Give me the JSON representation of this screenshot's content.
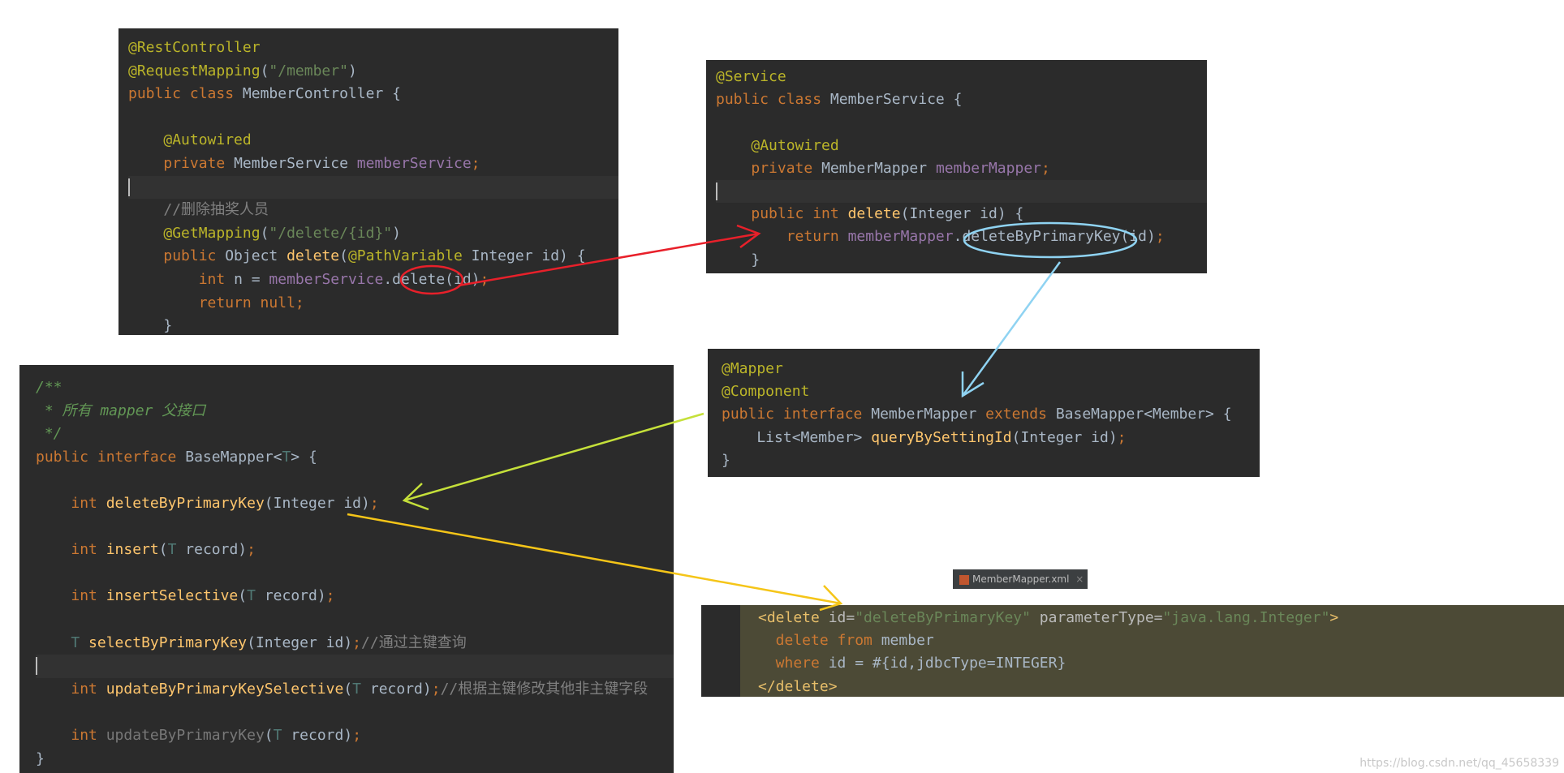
{
  "controller": {
    "lines": [
      {
        "parts": [
          {
            "t": "@RestController",
            "c": "ann"
          }
        ]
      },
      {
        "parts": [
          {
            "t": "@RequestMapping",
            "c": "ann"
          },
          {
            "t": "(",
            "c": ""
          },
          {
            "t": "\"/member\"",
            "c": "str"
          },
          {
            "t": ")",
            "c": ""
          }
        ]
      },
      {
        "parts": [
          {
            "t": "public class ",
            "c": "kw"
          },
          {
            "t": "MemberController {",
            "c": ""
          }
        ]
      },
      {
        "parts": []
      },
      {
        "parts": [
          {
            "t": "    ",
            "c": ""
          },
          {
            "t": "@Autowired",
            "c": "ann"
          }
        ]
      },
      {
        "parts": [
          {
            "t": "    ",
            "c": ""
          },
          {
            "t": "private ",
            "c": "kw"
          },
          {
            "t": "MemberService ",
            "c": ""
          },
          {
            "t": "memberService",
            "c": "fld"
          },
          {
            "t": ";",
            "c": "kw"
          }
        ]
      },
      {
        "parts": [],
        "cur": true
      },
      {
        "parts": [
          {
            "t": "    ",
            "c": ""
          },
          {
            "t": "//删除抽奖人员",
            "c": "cmt"
          }
        ]
      },
      {
        "parts": [
          {
            "t": "    ",
            "c": ""
          },
          {
            "t": "@GetMapping",
            "c": "ann"
          },
          {
            "t": "(",
            "c": ""
          },
          {
            "t": "\"/delete/{id}\"",
            "c": "str"
          },
          {
            "t": ")",
            "c": ""
          }
        ]
      },
      {
        "parts": [
          {
            "t": "    ",
            "c": ""
          },
          {
            "t": "public ",
            "c": "kw"
          },
          {
            "t": "Object ",
            "c": ""
          },
          {
            "t": "delete",
            "c": "fn"
          },
          {
            "t": "(",
            "c": ""
          },
          {
            "t": "@PathVariable ",
            "c": "ann"
          },
          {
            "t": "Integer id) {",
            "c": ""
          }
        ]
      },
      {
        "parts": [
          {
            "t": "        ",
            "c": ""
          },
          {
            "t": "int ",
            "c": "kw"
          },
          {
            "t": "n = ",
            "c": ""
          },
          {
            "t": "memberService",
            "c": "fld"
          },
          {
            "t": ".delete(id)",
            "c": ""
          },
          {
            "t": ";",
            "c": "kw"
          }
        ]
      },
      {
        "parts": [
          {
            "t": "        ",
            "c": ""
          },
          {
            "t": "return null;",
            "c": "kw"
          }
        ]
      },
      {
        "parts": [
          {
            "t": "    }",
            "c": ""
          }
        ]
      }
    ]
  },
  "service": {
    "lines": [
      {
        "parts": [
          {
            "t": "@Service",
            "c": "ann"
          }
        ]
      },
      {
        "parts": [
          {
            "t": "public class ",
            "c": "kw"
          },
          {
            "t": "MemberService {",
            "c": ""
          }
        ]
      },
      {
        "parts": []
      },
      {
        "parts": [
          {
            "t": "    ",
            "c": ""
          },
          {
            "t": "@Autowired",
            "c": "ann"
          }
        ]
      },
      {
        "parts": [
          {
            "t": "    ",
            "c": ""
          },
          {
            "t": "private ",
            "c": "kw"
          },
          {
            "t": "MemberMapper ",
            "c": ""
          },
          {
            "t": "memberMapper",
            "c": "fld"
          },
          {
            "t": ";",
            "c": "kw"
          }
        ]
      },
      {
        "parts": [],
        "cur": true
      },
      {
        "parts": [
          {
            "t": "    ",
            "c": ""
          },
          {
            "t": "public int ",
            "c": "kw"
          },
          {
            "t": "delete",
            "c": "fn"
          },
          {
            "t": "(Integer id) {",
            "c": ""
          }
        ]
      },
      {
        "parts": [
          {
            "t": "        ",
            "c": ""
          },
          {
            "t": "return ",
            "c": "kw"
          },
          {
            "t": "memberMapper",
            "c": "fld"
          },
          {
            "t": ".deleteByPrimaryKey(id)",
            "c": ""
          },
          {
            "t": ";",
            "c": "kw"
          }
        ]
      },
      {
        "parts": [
          {
            "t": "    }",
            "c": ""
          }
        ]
      }
    ]
  },
  "mapper": {
    "lines": [
      {
        "parts": [
          {
            "t": "@Mapper",
            "c": "ann"
          }
        ]
      },
      {
        "parts": [
          {
            "t": "@Component",
            "c": "ann"
          }
        ]
      },
      {
        "parts": [
          {
            "t": "public interface ",
            "c": "kw"
          },
          {
            "t": "MemberMapper ",
            "c": ""
          },
          {
            "t": "extends ",
            "c": "kw"
          },
          {
            "t": "BaseMapper<Member> {",
            "c": ""
          }
        ]
      },
      {
        "parts": [
          {
            "t": "    List<Member> ",
            "c": ""
          },
          {
            "t": "queryBySettingId",
            "c": "fn"
          },
          {
            "t": "(Integer id)",
            "c": ""
          },
          {
            "t": ";",
            "c": "kw"
          }
        ]
      },
      {
        "parts": [
          {
            "t": "}",
            "c": ""
          }
        ]
      }
    ]
  },
  "base": {
    "lines": [
      {
        "parts": [
          {
            "t": "/**",
            "c": "doc"
          }
        ]
      },
      {
        "parts": [
          {
            "t": " * 所有 mapper 父接口",
            "c": "doc"
          }
        ]
      },
      {
        "parts": [
          {
            "t": " */",
            "c": "doc"
          }
        ]
      },
      {
        "parts": [
          {
            "t": "public interface ",
            "c": "kw"
          },
          {
            "t": "BaseMapper<",
            "c": ""
          },
          {
            "t": "T",
            "c": "tp"
          },
          {
            "t": "> {",
            "c": ""
          }
        ]
      },
      {
        "parts": []
      },
      {
        "parts": [
          {
            "t": "    ",
            "c": ""
          },
          {
            "t": "int ",
            "c": "kw"
          },
          {
            "t": "deleteByPrimaryKey",
            "c": "fn"
          },
          {
            "t": "(Integer id)",
            "c": ""
          },
          {
            "t": ";",
            "c": "kw"
          }
        ]
      },
      {
        "parts": []
      },
      {
        "parts": [
          {
            "t": "    ",
            "c": ""
          },
          {
            "t": "int ",
            "c": "kw"
          },
          {
            "t": "insert",
            "c": "fn"
          },
          {
            "t": "(",
            "c": ""
          },
          {
            "t": "T ",
            "c": "tp"
          },
          {
            "t": "record)",
            "c": ""
          },
          {
            "t": ";",
            "c": "kw"
          }
        ]
      },
      {
        "parts": []
      },
      {
        "parts": [
          {
            "t": "    ",
            "c": ""
          },
          {
            "t": "int ",
            "c": "kw"
          },
          {
            "t": "insertSelective",
            "c": "fn"
          },
          {
            "t": "(",
            "c": ""
          },
          {
            "t": "T ",
            "c": "tp"
          },
          {
            "t": "record)",
            "c": ""
          },
          {
            "t": ";",
            "c": "kw"
          }
        ]
      },
      {
        "parts": []
      },
      {
        "parts": [
          {
            "t": "    ",
            "c": ""
          },
          {
            "t": "T ",
            "c": "tp"
          },
          {
            "t": "selectByPrimaryKey",
            "c": "fn"
          },
          {
            "t": "(Integer id)",
            "c": ""
          },
          {
            "t": ";",
            "c": "kw"
          },
          {
            "t": "//通过主键查询",
            "c": "cmt"
          }
        ]
      },
      {
        "parts": [],
        "cur": true
      },
      {
        "parts": [
          {
            "t": "    ",
            "c": ""
          },
          {
            "t": "int ",
            "c": "kw"
          },
          {
            "t": "updateByPrimaryKeySelective",
            "c": "fn"
          },
          {
            "t": "(",
            "c": ""
          },
          {
            "t": "T ",
            "c": "tp"
          },
          {
            "t": "record)",
            "c": ""
          },
          {
            "t": ";",
            "c": "kw"
          },
          {
            "t": "//根据主键修改其他非主键字段",
            "c": "cmt"
          }
        ]
      },
      {
        "parts": []
      },
      {
        "parts": [
          {
            "t": "    ",
            "c": ""
          },
          {
            "t": "int ",
            "c": "kw"
          },
          {
            "t": "updateByPrimaryKey",
            "c": "dim"
          },
          {
            "t": "(",
            "c": ""
          },
          {
            "t": "T ",
            "c": "tp"
          },
          {
            "t": "record)",
            "c": ""
          },
          {
            "t": ";",
            "c": "kw"
          }
        ]
      },
      {
        "parts": [
          {
            "t": "}",
            "c": ""
          }
        ]
      }
    ]
  },
  "xml": {
    "tab_label": "MemberMapper.xml",
    "tab_close": "×",
    "lines": [
      {
        "parts": [
          {
            "t": "<delete ",
            "c": "tag"
          },
          {
            "t": "id=",
            "c": "attr"
          },
          {
            "t": "\"deleteByPrimaryKey\" ",
            "c": "str"
          },
          {
            "t": "parameterType=",
            "c": "attr"
          },
          {
            "t": "\"java.lang.Integer\"",
            "c": "str"
          },
          {
            "t": ">",
            "c": "tag"
          }
        ]
      },
      {
        "parts": [
          {
            "t": "  delete from ",
            "c": "kw"
          },
          {
            "t": "member",
            "c": ""
          }
        ]
      },
      {
        "parts": [
          {
            "t": "  where ",
            "c": "kw"
          },
          {
            "t": "id = #{id,jdbcType=INTEGER}",
            "c": ""
          }
        ]
      },
      {
        "parts": [
          {
            "t": "</delete>",
            "c": "tag"
          }
        ]
      }
    ]
  },
  "watermark": "https://blog.csdn.net/qq_45658339",
  "colors": {
    "editor_bg": "#2b2b2b",
    "arrow_red": "#e8202a",
    "arrow_blue": "#8fd3f2",
    "arrow_green": "#c5e03a",
    "arrow_yellow": "#f5c518"
  }
}
